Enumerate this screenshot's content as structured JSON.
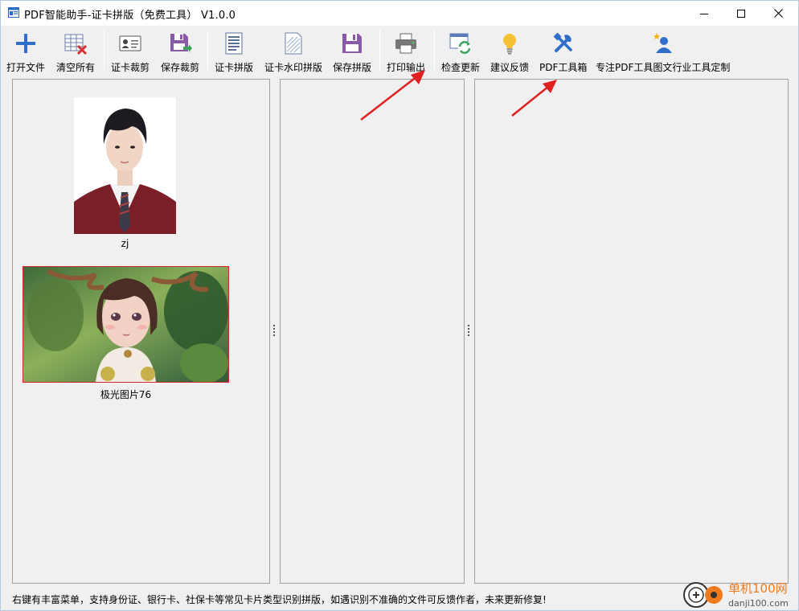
{
  "window": {
    "title": "PDF智能助手-证卡拼版（免费工具） V1.0.0"
  },
  "toolbar": {
    "open_file": "打开文件",
    "clear_all": "清空所有",
    "card_crop": "证卡裁剪",
    "save_crop": "保存裁剪",
    "card_layout": "证卡拼版",
    "card_watermark_layout": "证卡水印拼版",
    "save_layout": "保存拼版",
    "print_output": "打印输出",
    "check_update": "检查更新",
    "feedback": "建议反馈",
    "pdf_toolbox": "PDF工具箱",
    "custom_tools": "专注PDF工具图文行业工具定制"
  },
  "files": [
    {
      "name": "zj"
    },
    {
      "name": "极光图片76"
    }
  ],
  "status": {
    "hint": "右键有丰富菜单，支持身份证、银行卡、社保卡等常见卡片类型识别拼版，如遇识别不准确的文件可反馈作者，未来更新修复!"
  },
  "watermark": {
    "site_name": "单机100网",
    "site_url": "danji100.com"
  },
  "colors": {
    "arrow": "#e02020",
    "icon_blue": "#3a7bd5",
    "icon_purple": "#8a5aa8",
    "selected_border": "#d02828"
  }
}
